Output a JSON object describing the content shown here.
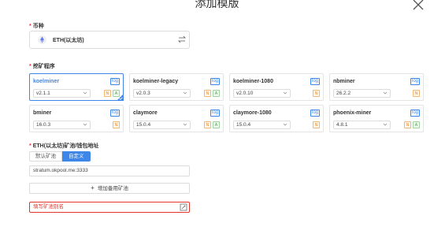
{
  "dialog": {
    "title": "添加模版"
  },
  "coin": {
    "label": "币种",
    "value": "ETH(以太坊)"
  },
  "miner": {
    "label": "挖矿程序",
    "cards": [
      {
        "name": "koelminer",
        "version": "v2.1.1",
        "tags": [
          "N",
          "A"
        ],
        "selected": true
      },
      {
        "name": "koelminer-legacy",
        "version": "v2.0.3",
        "tags": [
          "N",
          "A"
        ],
        "selected": false
      },
      {
        "name": "koelminer-1080",
        "version": "v2.0.10",
        "tags": [
          "N"
        ],
        "selected": false
      },
      {
        "name": "nbminer",
        "version": "26.2.2",
        "tags": [
          "N"
        ],
        "selected": false
      },
      {
        "name": "bminer",
        "version": "16.0.3",
        "tags": [
          "N"
        ],
        "selected": false
      },
      {
        "name": "claymore",
        "version": "15.0.4",
        "tags": [
          "N",
          "A"
        ],
        "selected": false
      },
      {
        "name": "claymore-1080",
        "version": "15.0.4",
        "tags": [
          "N"
        ],
        "selected": false
      },
      {
        "name": "phoenix-miner",
        "version": "4.8.1",
        "tags": [
          "N",
          "A"
        ],
        "selected": false
      }
    ],
    "log_label": "log"
  },
  "pool": {
    "label": "ETH(以太坊)矿池/钱包地址",
    "tabs": [
      "默认矿池",
      "自定义"
    ],
    "active_tab": 1,
    "address_value": "stratum.okpool.me:3333",
    "add_button": "增加备用矿池",
    "alias_placeholder": "填写矿池别名"
  },
  "colors": {
    "accent": "#3e87e8",
    "error": "#e5342b",
    "tag_n": "#e68a2e",
    "tag_a": "#4aa34a"
  }
}
